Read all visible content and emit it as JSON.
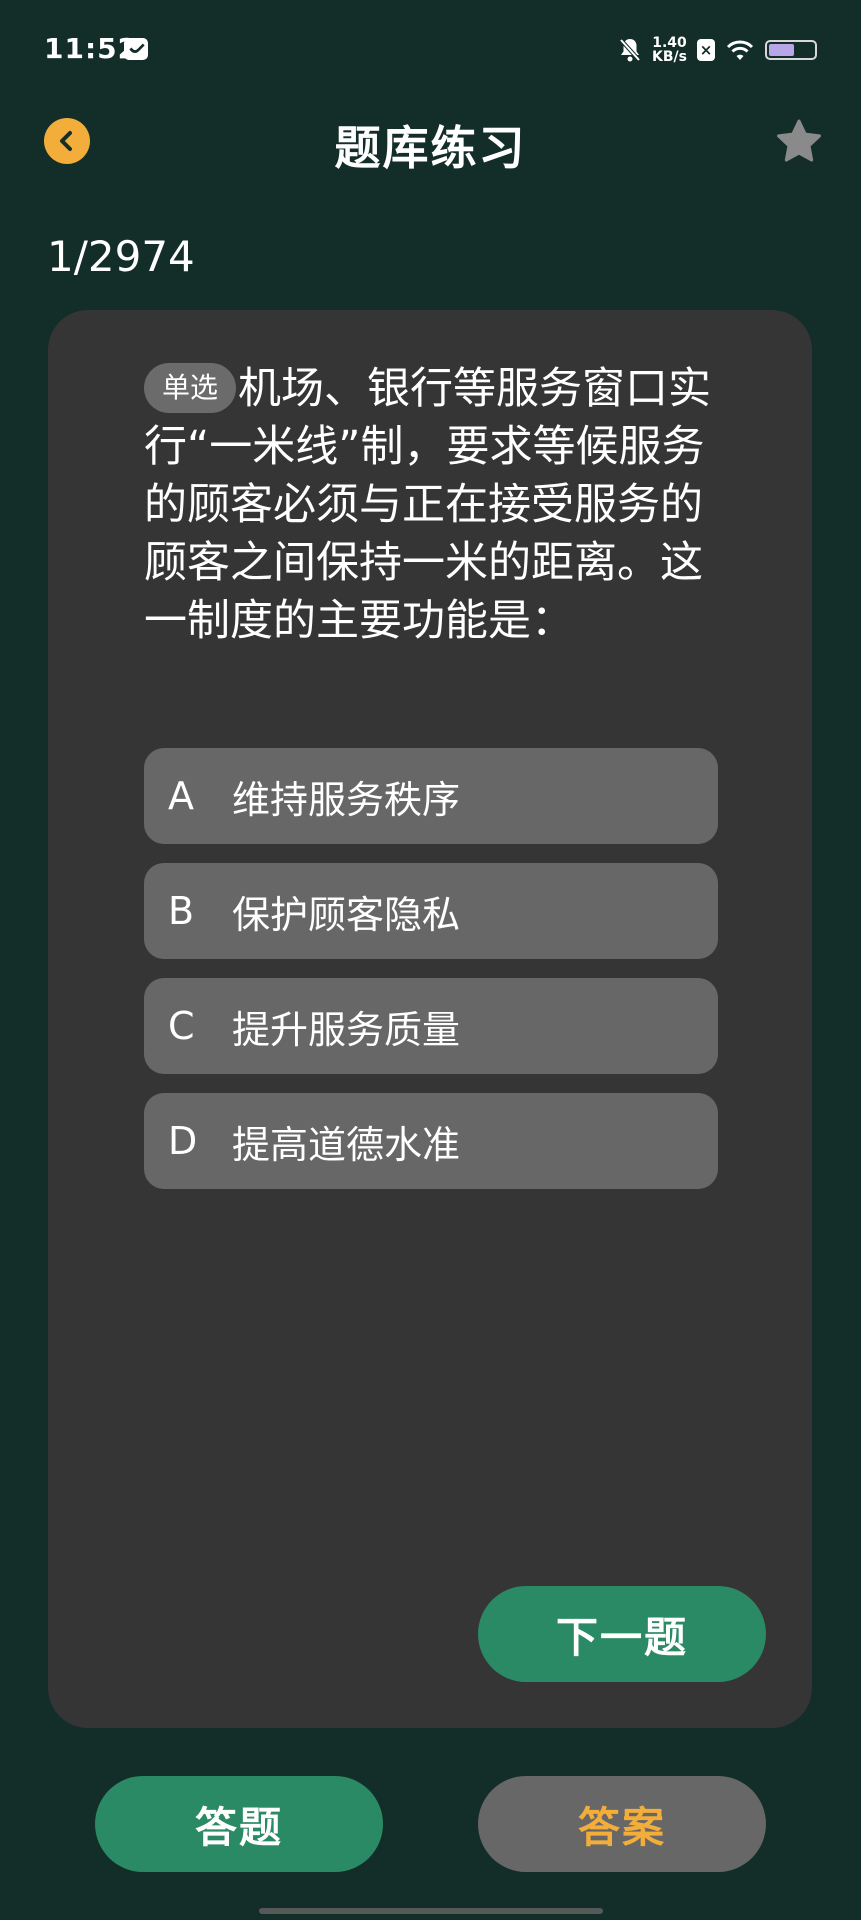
{
  "status_bar": {
    "time": "11:52",
    "net_speed_value": "1.40",
    "net_speed_unit": "KB/s",
    "battery_level": 0.6,
    "icons": [
      "message-icon",
      "mute-icon",
      "sim-icon",
      "wifi-icon",
      "battery-icon"
    ]
  },
  "header": {
    "title": "题库练习",
    "back_icon": "chevron-left-icon",
    "favorite_icon": "star-icon"
  },
  "progress": {
    "text": "1/2974"
  },
  "question": {
    "type_badge": "单选",
    "text": "机场、银行等服务窗口实行“一米线”制，要求等候服务的顾客必须与正在接受服务的顾客之间保持一米的距离。这一制度的主要功能是："
  },
  "options": [
    {
      "letter": "A",
      "text": "维持服务秩序"
    },
    {
      "letter": "B",
      "text": "保护顾客隐私"
    },
    {
      "letter": "C",
      "text": "提升服务质量"
    },
    {
      "letter": "D",
      "text": "提高道德水准"
    }
  ],
  "buttons": {
    "next": "下一题",
    "answer_mode": "答题",
    "solution_mode": "答案"
  },
  "colors": {
    "background": "#132d28",
    "card": "#353535",
    "option": "#676767",
    "primary_green": "#2a8a65",
    "accent_orange": "#f2ad3a"
  }
}
